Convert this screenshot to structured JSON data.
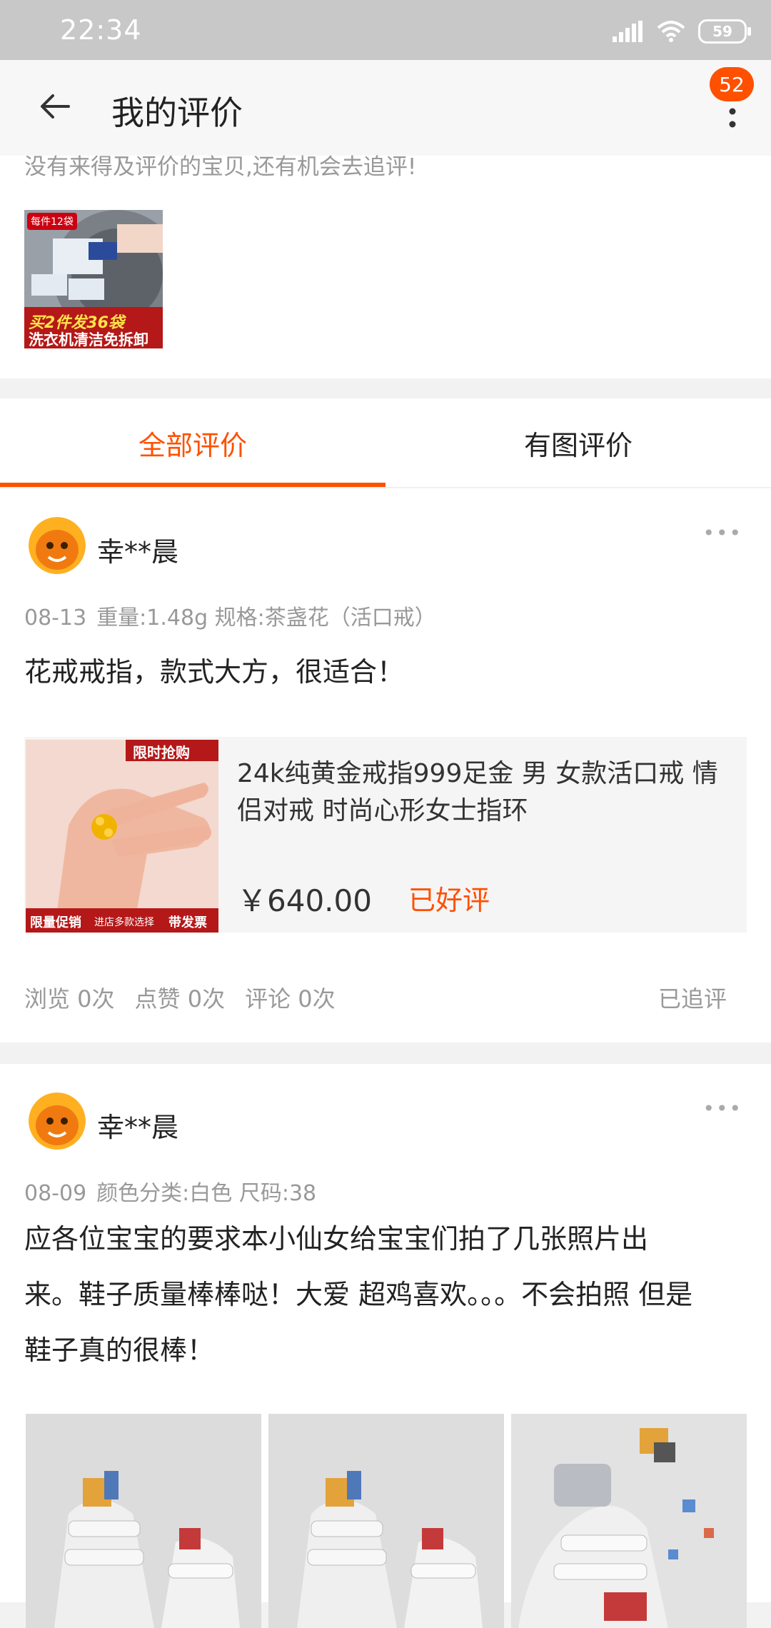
{
  "status_bar": {
    "time": "22:34",
    "battery": "59"
  },
  "header": {
    "title": "我的评价",
    "badge_count": "52"
  },
  "pending": {
    "hint": "没有来得及评价的宝贝,还有机会去追评!",
    "thumb_tag": "每件12袋",
    "thumb_text1": "买2件发36袋",
    "thumb_text2": "洗衣机清洁免拆卸"
  },
  "tabs": [
    {
      "label": "全部评价",
      "active": true
    },
    {
      "label": "有图评价",
      "active": false
    }
  ],
  "reviews": [
    {
      "user": "幸**晨",
      "date": "08-13",
      "sku": "重量:1.48g 规格:茶盏花（活口戒）",
      "content": "花戒戒指，款式大方，很适合！",
      "product": {
        "name": "24k纯黄金戒指999足金 男 女款活口戒 情侣对戒 时尚心形女士指环",
        "price": "￥640.00",
        "status": "已好评",
        "img_tag": "限时抢购",
        "img_bottom1": "限量促销",
        "img_bottom2": "进店多款选择",
        "img_bottom3": "带发票"
      },
      "stats": {
        "views": "浏览 0次",
        "likes": "点赞 0次",
        "comments": "评论 0次"
      },
      "followup": "已追评"
    },
    {
      "user": "幸**晨",
      "date": "08-09",
      "sku": "颜色分类:白色 尺码:38",
      "content_line1": "应各位宝宝的要求本小仙女给宝宝们拍了几张照片出",
      "content_line2": "来。鞋子质量棒棒哒！大爱 超鸡喜欢。。。不会拍照 但是",
      "content_line3": "鞋子真的很棒！"
    }
  ],
  "colors": {
    "accent": "#ff5000",
    "muted": "#999999"
  }
}
